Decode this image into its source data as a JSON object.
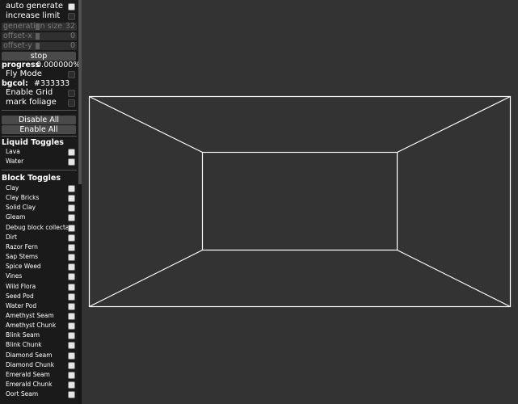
{
  "colors": {
    "background": "#333333",
    "panel": "#1a1a1a",
    "wireframe": "#ffffff"
  },
  "controls": {
    "auto_generate": {
      "label": "auto generate",
      "checked": true
    },
    "increase_limit": {
      "label": "increase limit",
      "checked": false
    },
    "generation_size": {
      "label": "generation size",
      "value": "32",
      "level": 0.5
    },
    "offset_x": {
      "label": "offset-x",
      "value": "0",
      "level": 0.5
    },
    "offset_y": {
      "label": "offset-y",
      "value": "0",
      "level": 0.5
    },
    "stop_label": "stop",
    "progress_label": "progress",
    "progress_value": "0.000000%",
    "fly_mode": {
      "label": "Fly Mode",
      "checked": false
    },
    "bgcol_label": "bgcol:",
    "bgcol_value": "#333333",
    "enable_grid": {
      "label": "Enable Grid",
      "checked": false
    },
    "mark_foliage": {
      "label": "mark foliage",
      "checked": false
    },
    "disable_all_label": "Disable All",
    "enable_all_label": "Enable All"
  },
  "liquid_toggles": {
    "title": "Liquid Toggles",
    "items": [
      {
        "label": "Lava",
        "checked": true
      },
      {
        "label": "Water",
        "checked": true
      }
    ]
  },
  "block_toggles": {
    "title": "Block Toggles",
    "items": [
      {
        "label": "Clay",
        "checked": true
      },
      {
        "label": "Clay Bricks",
        "checked": true
      },
      {
        "label": "Solid Clay",
        "checked": true
      },
      {
        "label": "Gleam",
        "checked": true
      },
      {
        "label": "Debug block collectable",
        "checked": true
      },
      {
        "label": "Dirt",
        "checked": true
      },
      {
        "label": "Razor Fern",
        "checked": true
      },
      {
        "label": "Sap Stems",
        "checked": true
      },
      {
        "label": "Spice Weed",
        "checked": true
      },
      {
        "label": "Vines",
        "checked": true
      },
      {
        "label": "Wild Flora",
        "checked": true
      },
      {
        "label": "Seed Pod",
        "checked": true
      },
      {
        "label": "Water Pod",
        "checked": true
      },
      {
        "label": "Amethyst Seam",
        "checked": true
      },
      {
        "label": "Amethyst Chunk",
        "checked": true
      },
      {
        "label": "Blink Seam",
        "checked": true
      },
      {
        "label": "Blink Chunk",
        "checked": true
      },
      {
        "label": "Diamond Seam",
        "checked": true
      },
      {
        "label": "Diamond Chunk",
        "checked": true
      },
      {
        "label": "Emerald Seam",
        "checked": true
      },
      {
        "label": "Emerald Chunk",
        "checked": true
      },
      {
        "label": "Oort Seam",
        "checked": true
      }
    ]
  }
}
